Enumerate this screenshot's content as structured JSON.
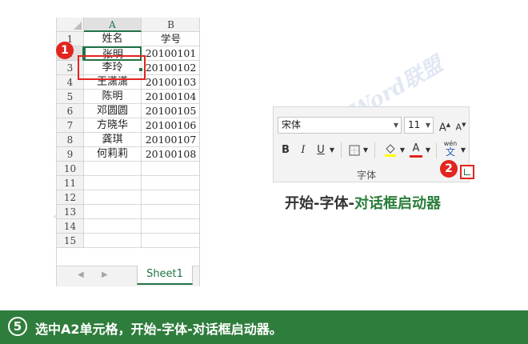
{
  "spreadsheet": {
    "columns": [
      "A",
      "B"
    ],
    "rows": [
      {
        "num": "1",
        "a": "姓名",
        "b": "学号"
      },
      {
        "num": "2",
        "a": "张明",
        "b": "20100101"
      },
      {
        "num": "3",
        "a": "李玲",
        "b": "20100102"
      },
      {
        "num": "4",
        "a": "王潇潇",
        "b": "20100103"
      },
      {
        "num": "5",
        "a": "陈明",
        "b": "20100104"
      },
      {
        "num": "6",
        "a": "邓圆圆",
        "b": "20100105"
      },
      {
        "num": "7",
        "a": "方晓华",
        "b": "20100106"
      },
      {
        "num": "8",
        "a": "龚琪",
        "b": "20100107"
      },
      {
        "num": "9",
        "a": "何莉莉",
        "b": "20100108"
      },
      {
        "num": "10",
        "a": "",
        "b": ""
      },
      {
        "num": "11",
        "a": "",
        "b": ""
      },
      {
        "num": "12",
        "a": "",
        "b": ""
      },
      {
        "num": "13",
        "a": "",
        "b": ""
      },
      {
        "num": "14",
        "a": "",
        "b": ""
      },
      {
        "num": "15",
        "a": "",
        "b": ""
      }
    ],
    "sheet_tab": "Sheet1",
    "nav_left": "◀",
    "nav_right": "▶",
    "accent": "#217346"
  },
  "badges": {
    "one": "1",
    "two": "2"
  },
  "ribbon": {
    "font_name": "宋体",
    "font_size": "11",
    "grow": "A",
    "shrink": "A",
    "bold": "B",
    "italic": "I",
    "underline": "U",
    "font_color_letter": "A",
    "phonetic_top": "wén",
    "phonetic_bottom": "文",
    "group_label": "字体"
  },
  "caption": {
    "part1": "开始-字体-",
    "part2": "对话框启动器"
  },
  "watermark": {
    "text": "Word联盟"
  },
  "footer": {
    "step": "5",
    "text": "选中A2单元格，开始-字体-对话框启动器。"
  },
  "colors": {
    "highlight": "#e2251f",
    "bar": "#2f7d3c"
  }
}
